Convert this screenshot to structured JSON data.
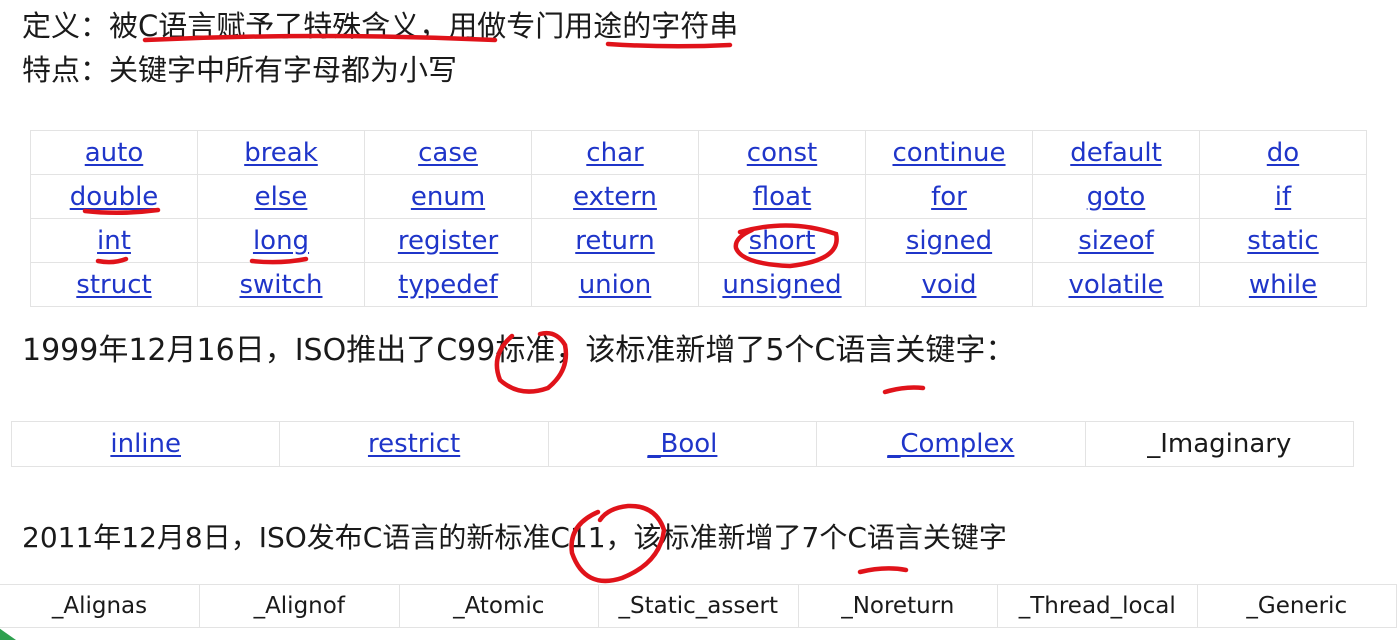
{
  "definition": "定义：被C语言赋予了特殊含义，用做专门用途的字符串",
  "feature": "特点：关键字中所有字母都为小写",
  "keyword_rows": [
    [
      "auto",
      "break",
      "case",
      "char",
      "const",
      "continue",
      "default",
      "do"
    ],
    [
      "double",
      "else",
      "enum",
      "extern",
      "float",
      "for",
      "goto",
      "if"
    ],
    [
      "int",
      "long",
      "register",
      "return",
      "short",
      "signed",
      "sizeof",
      "static"
    ],
    [
      "struct",
      "switch",
      "typedef",
      "union",
      "unsigned",
      "void",
      "volatile",
      "while"
    ]
  ],
  "c99_note": "1999年12月16日，ISO推出了C99标准，该标准新增了5个C语言关键字：",
  "c99_keywords": [
    {
      "text": "inline",
      "link": true
    },
    {
      "text": "restrict",
      "link": true
    },
    {
      "text": "_Bool",
      "link": true
    },
    {
      "text": "_Complex",
      "link": true
    },
    {
      "text": "_Imaginary",
      "link": false
    }
  ],
  "c11_note": "2011年12月8日，ISO发布C语言的新标准C11，该标准新增了7个C语言关键字",
  "c11_keywords": [
    "_Alignas",
    "_Alignof",
    "_Atomic",
    "_Static_assert",
    "_Noreturn",
    "_Thread_local",
    "_Generic"
  ],
  "colors": {
    "link": "#1f35c9",
    "annotation": "#e0131a",
    "grid": "#e3e3e3"
  }
}
